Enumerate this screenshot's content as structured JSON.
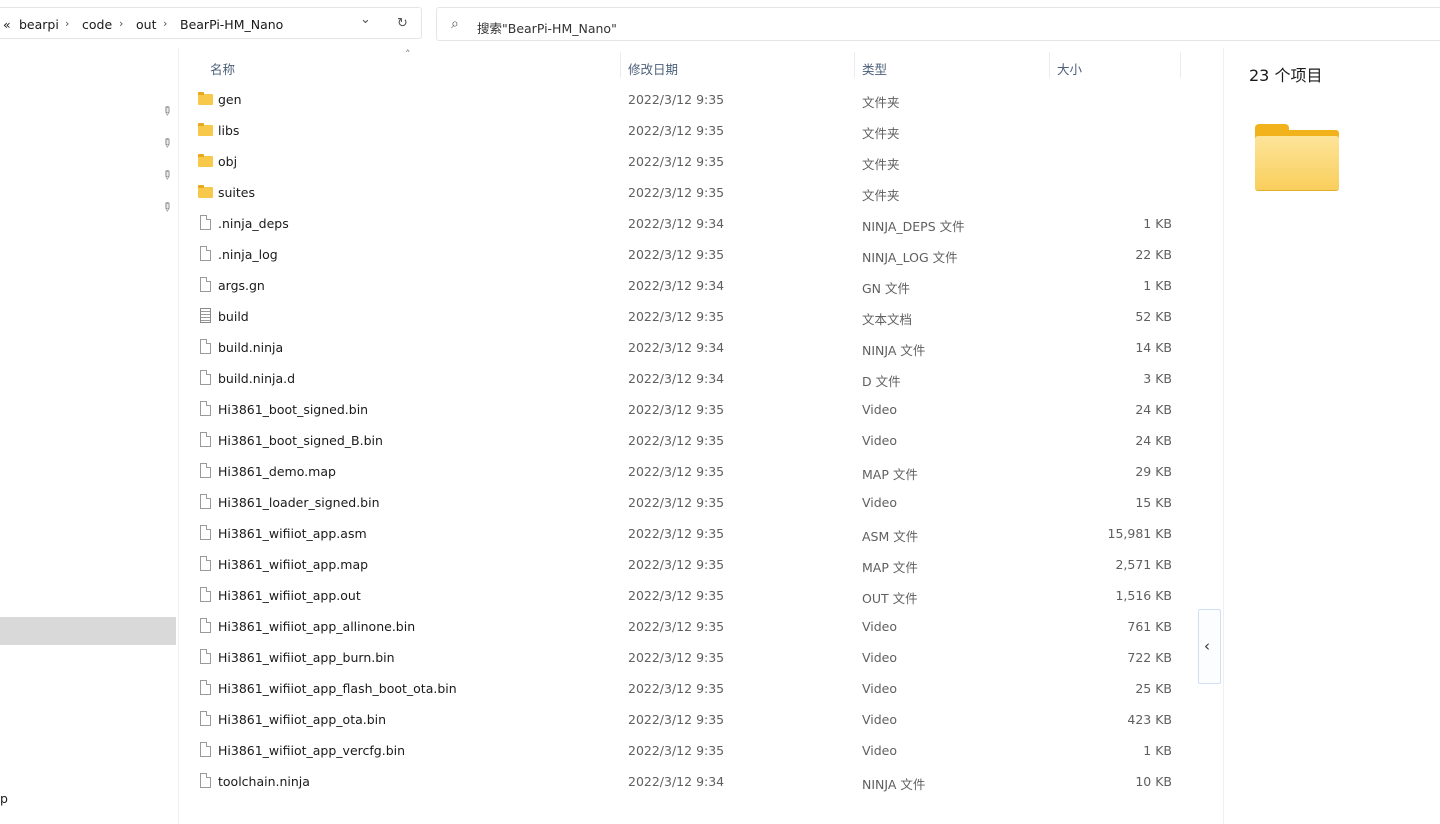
{
  "address_bar": {
    "overflow": "«",
    "crumbs": [
      "bearpi",
      "code",
      "out",
      "BearPi-HM_Nano"
    ],
    "separator": "›",
    "dropdown_icon": "⌄",
    "refresh_icon": "↻"
  },
  "search": {
    "placeholder": "搜索\"BearPi-HM_Nano\"",
    "icon": "⌕"
  },
  "columns": {
    "name": "名称",
    "date": "修改日期",
    "type": "类型",
    "size": "大小"
  },
  "sort_indicator": "˄",
  "nav": {
    "pin_icon": "📌",
    "bottom_label": "p"
  },
  "files": [
    {
      "name": "gen",
      "date": "2022/3/12 9:35",
      "type": "文件夹",
      "size": "",
      "icon": "folder"
    },
    {
      "name": "libs",
      "date": "2022/3/12 9:35",
      "type": "文件夹",
      "size": "",
      "icon": "folder"
    },
    {
      "name": "obj",
      "date": "2022/3/12 9:35",
      "type": "文件夹",
      "size": "",
      "icon": "folder"
    },
    {
      "name": "suites",
      "date": "2022/3/12 9:35",
      "type": "文件夹",
      "size": "",
      "icon": "folder"
    },
    {
      "name": ".ninja_deps",
      "date": "2022/3/12 9:34",
      "type": "NINJA_DEPS 文件",
      "size": "1 KB",
      "icon": "file"
    },
    {
      "name": ".ninja_log",
      "date": "2022/3/12 9:35",
      "type": "NINJA_LOG 文件",
      "size": "22 KB",
      "icon": "file"
    },
    {
      "name": "args.gn",
      "date": "2022/3/12 9:34",
      "type": "GN 文件",
      "size": "1 KB",
      "icon": "file"
    },
    {
      "name": "build",
      "date": "2022/3/12 9:35",
      "type": "文本文档",
      "size": "52 KB",
      "icon": "text"
    },
    {
      "name": "build.ninja",
      "date": "2022/3/12 9:34",
      "type": "NINJA 文件",
      "size": "14 KB",
      "icon": "file"
    },
    {
      "name": "build.ninja.d",
      "date": "2022/3/12 9:34",
      "type": "D 文件",
      "size": "3 KB",
      "icon": "file"
    },
    {
      "name": "Hi3861_boot_signed.bin",
      "date": "2022/3/12 9:35",
      "type": "Video",
      "size": "24 KB",
      "icon": "file"
    },
    {
      "name": "Hi3861_boot_signed_B.bin",
      "date": "2022/3/12 9:35",
      "type": "Video",
      "size": "24 KB",
      "icon": "file"
    },
    {
      "name": "Hi3861_demo.map",
      "date": "2022/3/12 9:35",
      "type": "MAP 文件",
      "size": "29 KB",
      "icon": "file"
    },
    {
      "name": "Hi3861_loader_signed.bin",
      "date": "2022/3/12 9:35",
      "type": "Video",
      "size": "15 KB",
      "icon": "file"
    },
    {
      "name": "Hi3861_wifiiot_app.asm",
      "date": "2022/3/12 9:35",
      "type": "ASM 文件",
      "size": "15,981 KB",
      "icon": "file"
    },
    {
      "name": "Hi3861_wifiiot_app.map",
      "date": "2022/3/12 9:35",
      "type": "MAP 文件",
      "size": "2,571 KB",
      "icon": "file"
    },
    {
      "name": "Hi3861_wifiiot_app.out",
      "date": "2022/3/12 9:35",
      "type": "OUT 文件",
      "size": "1,516 KB",
      "icon": "file"
    },
    {
      "name": "Hi3861_wifiiot_app_allinone.bin",
      "date": "2022/3/12 9:35",
      "type": "Video",
      "size": "761 KB",
      "icon": "file"
    },
    {
      "name": "Hi3861_wifiiot_app_burn.bin",
      "date": "2022/3/12 9:35",
      "type": "Video",
      "size": "722 KB",
      "icon": "file"
    },
    {
      "name": "Hi3861_wifiiot_app_flash_boot_ota.bin",
      "date": "2022/3/12 9:35",
      "type": "Video",
      "size": "25 KB",
      "icon": "file"
    },
    {
      "name": "Hi3861_wifiiot_app_ota.bin",
      "date": "2022/3/12 9:35",
      "type": "Video",
      "size": "423 KB",
      "icon": "file"
    },
    {
      "name": "Hi3861_wifiiot_app_vercfg.bin",
      "date": "2022/3/12 9:35",
      "type": "Video",
      "size": "1 KB",
      "icon": "file"
    },
    {
      "name": "toolchain.ninja",
      "date": "2022/3/12 9:34",
      "type": "NINJA 文件",
      "size": "10 KB",
      "icon": "file"
    }
  ],
  "details": {
    "count": "23 个项目"
  },
  "toggle_icon": "‹",
  "colors": {
    "folder": "#f8c84a",
    "header_text": "#4c607a",
    "nav_selected": "#d9d9d9"
  }
}
